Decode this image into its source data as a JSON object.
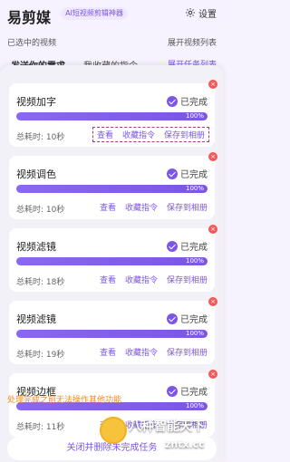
{
  "header": {
    "logo_text": "易剪媒",
    "badge_text": "AI短视频剪辑神器",
    "settings_label": "设置"
  },
  "selected": {
    "label": "已选中的视频",
    "expand_label": "展开视频列表"
  },
  "tabs": {
    "tab1": "发送你的需求",
    "tab2": "我收藏的指令",
    "tab3": "展开任务列表"
  },
  "tasks": [
    {
      "title": "视频加字",
      "status": "已完成",
      "progress_pct": "100%",
      "time": "总耗时: 10秒",
      "actions": [
        "查看",
        "收藏指令",
        "保存到相册"
      ]
    },
    {
      "title": "视频调色",
      "status": "已完成",
      "progress_pct": "100%",
      "time": "总耗时: 10秒",
      "actions": [
        "查看",
        "收藏指令",
        "保存到相册"
      ]
    },
    {
      "title": "视频滤镜",
      "status": "已完成",
      "progress_pct": "100%",
      "time": "总耗时: 18秒",
      "actions": [
        "查看",
        "收藏指令",
        "保存到相册"
      ]
    },
    {
      "title": "视频滤镜",
      "status": "已完成",
      "progress_pct": "100%",
      "time": "总耗时: 19秒",
      "actions": [
        "查看",
        "收藏指令",
        "保存到相册"
      ]
    },
    {
      "title": "视频边框",
      "status": "已完成",
      "progress_pct": "100%",
      "time": "总耗时: 11秒",
      "actions": [
        "查看",
        "收藏指令",
        "保存到相册"
      ]
    }
  ],
  "notice": "处理完成之前无法操作其他功能",
  "bottom_button": "关闭并删除未完成任务",
  "watermark": {
    "text": "八种智能天下",
    "domain": "zntx.cc"
  },
  "colors": {
    "accent": "#7b56e6",
    "notice": "#f08a1a",
    "close": "#ef5a5a"
  }
}
